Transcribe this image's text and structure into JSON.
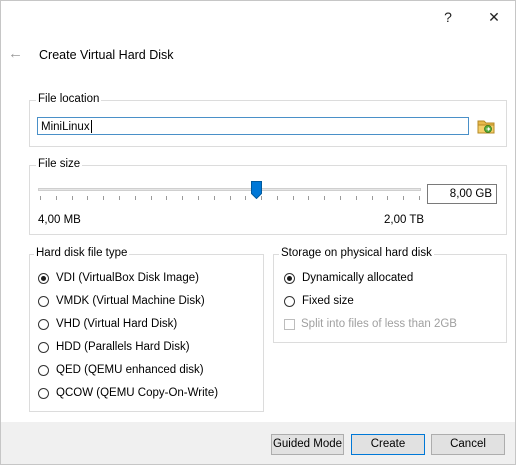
{
  "window": {
    "help_glyph": "?",
    "close_glyph": "✕"
  },
  "header": {
    "back_glyph": "←",
    "title": "Create Virtual Hard Disk"
  },
  "file_location": {
    "legend": "File location",
    "value": "MiniLinux"
  },
  "file_size": {
    "legend": "File size",
    "value": "8,00 GB",
    "min_label": "4,00 MB",
    "max_label": "2,00 TB",
    "slider_fraction": 0.57
  },
  "file_type": {
    "legend": "Hard disk file type",
    "options": [
      {
        "label": "VDI (VirtualBox Disk Image)",
        "selected": true
      },
      {
        "label": "VMDK (Virtual Machine Disk)",
        "selected": false
      },
      {
        "label": "VHD (Virtual Hard Disk)",
        "selected": false
      },
      {
        "label": "HDD (Parallels Hard Disk)",
        "selected": false
      },
      {
        "label": "QED (QEMU enhanced disk)",
        "selected": false
      },
      {
        "label": "QCOW (QEMU Copy-On-Write)",
        "selected": false
      }
    ]
  },
  "storage": {
    "legend": "Storage on physical hard disk",
    "options": [
      {
        "label": "Dynamically allocated",
        "selected": true
      },
      {
        "label": "Fixed size",
        "selected": false
      }
    ],
    "split_label": "Split into files of less than 2GB",
    "split_checked": false,
    "split_enabled": false
  },
  "buttons": {
    "guided": "Guided Mode",
    "create": "Create",
    "cancel": "Cancel"
  },
  "colors": {
    "accent": "#0078d7",
    "input_border": "#4a90c8"
  }
}
